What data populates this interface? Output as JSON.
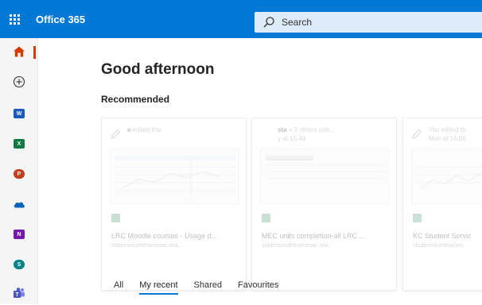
{
  "header": {
    "app_name": "Office 365",
    "search_placeholder": "Search"
  },
  "colors": {
    "topbar": "#0078d4",
    "search_bg": "#deecf9",
    "active_tab": "#0078d4",
    "home_active": "#d83b01"
  },
  "rail": {
    "items": [
      {
        "name": "Home",
        "icon": "home-icon"
      },
      {
        "name": "Create",
        "icon": "plus-icon"
      },
      {
        "name": "Word",
        "icon": "word-icon",
        "letter": "W",
        "color": "#185abd"
      },
      {
        "name": "Excel",
        "icon": "excel-icon",
        "letter": "X",
        "color": "#107c41"
      },
      {
        "name": "PowerPoint",
        "icon": "powerpoint-icon",
        "letter": "P",
        "color": "#c43e1c"
      },
      {
        "name": "OneDrive",
        "icon": "onedrive-icon",
        "color": "#0364b8"
      },
      {
        "name": "OneNote",
        "icon": "onenote-icon",
        "letter": "N",
        "color": "#7719aa"
      },
      {
        "name": "SharePoint",
        "icon": "sharepoint-icon",
        "letter": "S",
        "color": "#038387"
      },
      {
        "name": "Teams",
        "icon": "teams-icon",
        "color": "#5059c9"
      }
    ]
  },
  "main": {
    "greeting": "Good afternoon",
    "recommended_title": "Recommended",
    "cards": [
      {
        "activity_bold": "e",
        "activity_text": " edited this",
        "name": "LRC Moodle courses - Usage d...",
        "site": "studentsouththamesac.sha..."
      },
      {
        "activity_bold": "sta",
        "activity_text": " + 3 others edit...",
        "activity_line2": "y at 15:40",
        "name": "MEC units completion-all LRC ...",
        "site": "studentsouththamesac.sha..."
      },
      {
        "activity_bold": "",
        "activity_text": "You edited th",
        "activity_line2": "Mon at 16:06",
        "name": "KC Student Servic",
        "site": "studentsouththames"
      }
    ],
    "tabs": [
      {
        "label": "All",
        "active": false
      },
      {
        "label": "My recent",
        "active": true
      },
      {
        "label": "Shared",
        "active": false
      },
      {
        "label": "Favourites",
        "active": false
      }
    ]
  }
}
